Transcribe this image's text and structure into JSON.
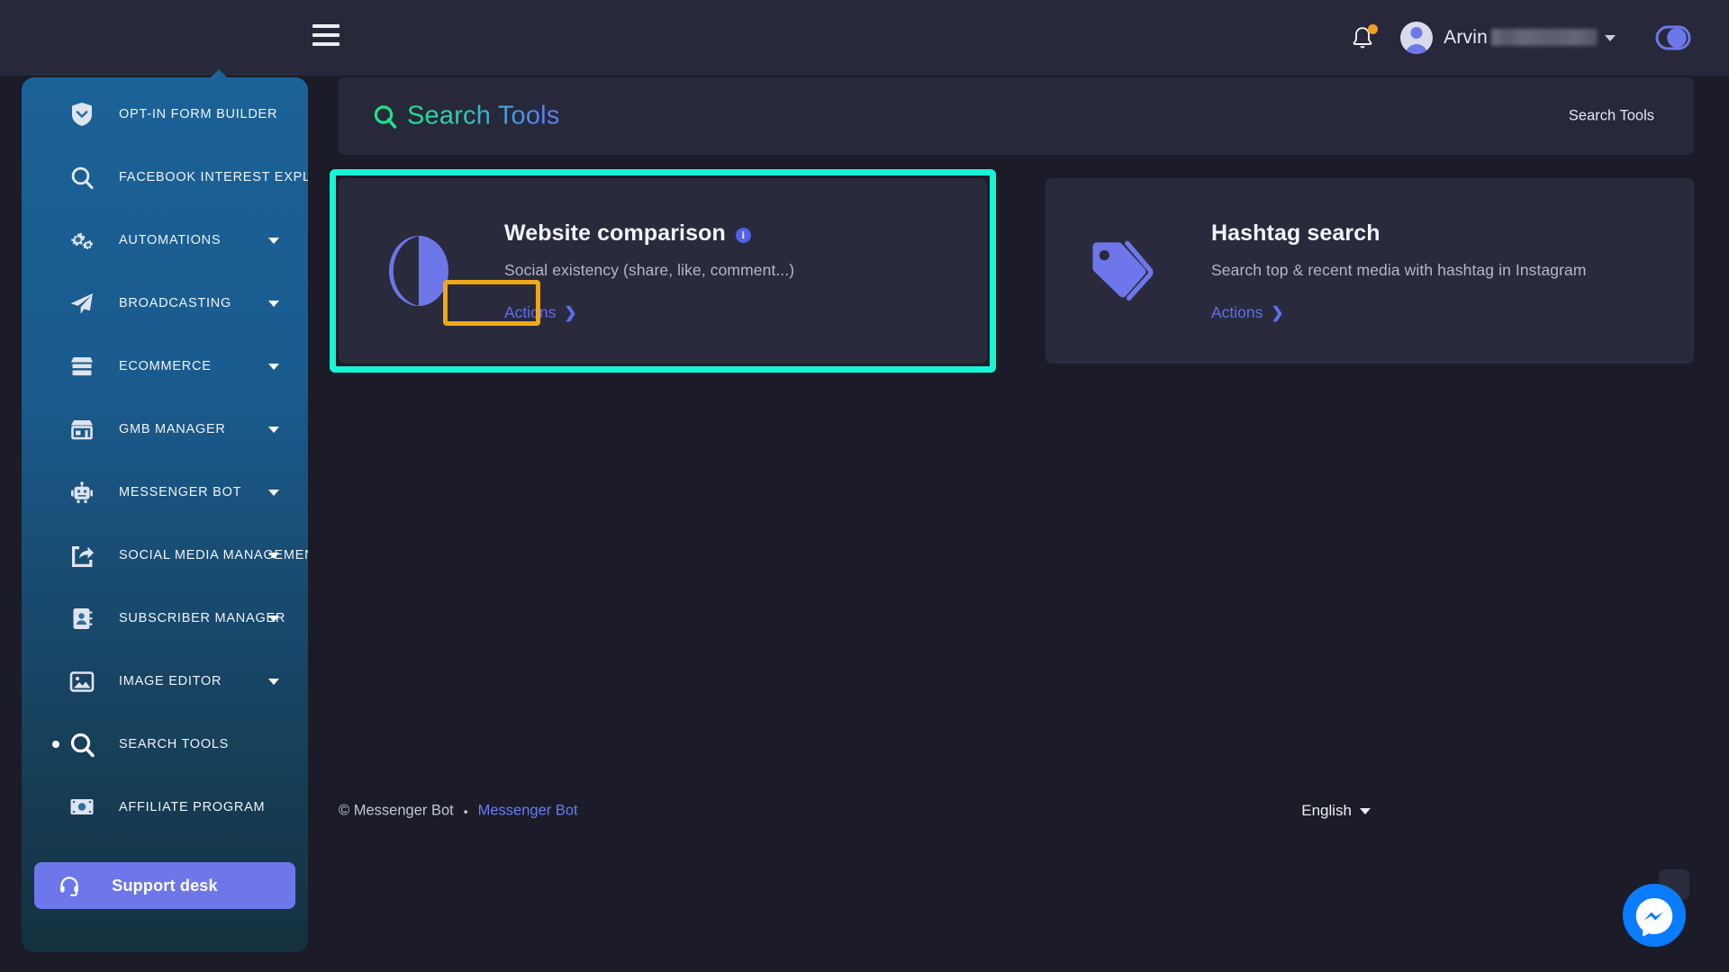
{
  "header": {
    "menu_icon": "hamburger-menu-icon",
    "notification_icon": "bell-icon",
    "user_name": "Arvin",
    "user_caret": "chevron-down-icon",
    "darkmode_icon": "dark-mode-toggle-icon"
  },
  "sidebar": {
    "items": [
      {
        "label": "OPT-IN FORM BUILDER",
        "icon": "shield-chevron-icon",
        "has_caret": false,
        "active": false
      },
      {
        "label": "FACEBOOK INTEREST EXPLORER",
        "icon": "search-icon",
        "has_caret": false,
        "active": false
      },
      {
        "label": "AUTOMATIONS",
        "icon": "gears-icon",
        "has_caret": true,
        "active": false
      },
      {
        "label": "BROADCASTING",
        "icon": "paper-plane-icon",
        "has_caret": true,
        "active": false
      },
      {
        "label": "ECOMMERCE",
        "icon": "storefront-icon",
        "has_caret": true,
        "active": false
      },
      {
        "label": "GMB MANAGER",
        "icon": "shop-icon",
        "has_caret": true,
        "active": false
      },
      {
        "label": "MESSENGER BOT",
        "icon": "robot-icon",
        "has_caret": true,
        "active": false
      },
      {
        "label": "SOCIAL MEDIA MANAGEMENT",
        "icon": "share-icon",
        "has_caret": true,
        "active": false
      },
      {
        "label": "SUBSCRIBER MANAGER",
        "icon": "contact-book-icon",
        "has_caret": true,
        "active": false
      },
      {
        "label": "IMAGE EDITOR",
        "icon": "image-icon",
        "has_caret": true,
        "active": false
      },
      {
        "label": "SEARCH TOOLS",
        "icon": "search-icon",
        "has_caret": false,
        "active": true
      },
      {
        "label": "AFFILIATE PROGRAM",
        "icon": "money-icon",
        "has_caret": false,
        "active": false
      }
    ],
    "support_button": {
      "label": "Support desk",
      "icon": "headset-icon"
    }
  },
  "page": {
    "title": "Search Tools",
    "title_icon": "search-icon",
    "breadcrumb": "Search Tools"
  },
  "cards": [
    {
      "title": "Website comparison",
      "description": "Social existency (share, like, comment...)",
      "action_label": "Actions",
      "action_chevron": "chevron-right-icon",
      "icon": "contrast-circle-icon",
      "info_badge": "i",
      "highlighted": true,
      "action_highlighted": true
    },
    {
      "title": "Hashtag search",
      "description": "Search top & recent media with hashtag in Instagram",
      "action_label": "Actions",
      "action_chevron": "chevron-right-icon",
      "icon": "tags-icon",
      "info_badge": null,
      "highlighted": false,
      "action_highlighted": false
    }
  ],
  "footer": {
    "copyright": "© Messenger Bot",
    "separator": "•",
    "link": "Messenger Bot",
    "language": "English",
    "language_caret": "chevron-down-icon"
  },
  "fab": {
    "icon": "messenger-icon"
  },
  "colors": {
    "page_bg": "#1b1c28",
    "panel_bg": "#272839",
    "card_bg": "#292b3c",
    "accent_purple": "#6d77ea",
    "accent_link": "#5f6ff0",
    "highlight_cyan": "#17f5d6",
    "highlight_orange": "#f0a818",
    "sidebar_top": "#1b6298",
    "sidebar_bottom": "#15313f",
    "title_gradient_start": "#1fe08c",
    "title_gradient_end": "#5d7bf0",
    "notification_badge": "#eda320",
    "messenger_blue": "#0a7cff"
  }
}
